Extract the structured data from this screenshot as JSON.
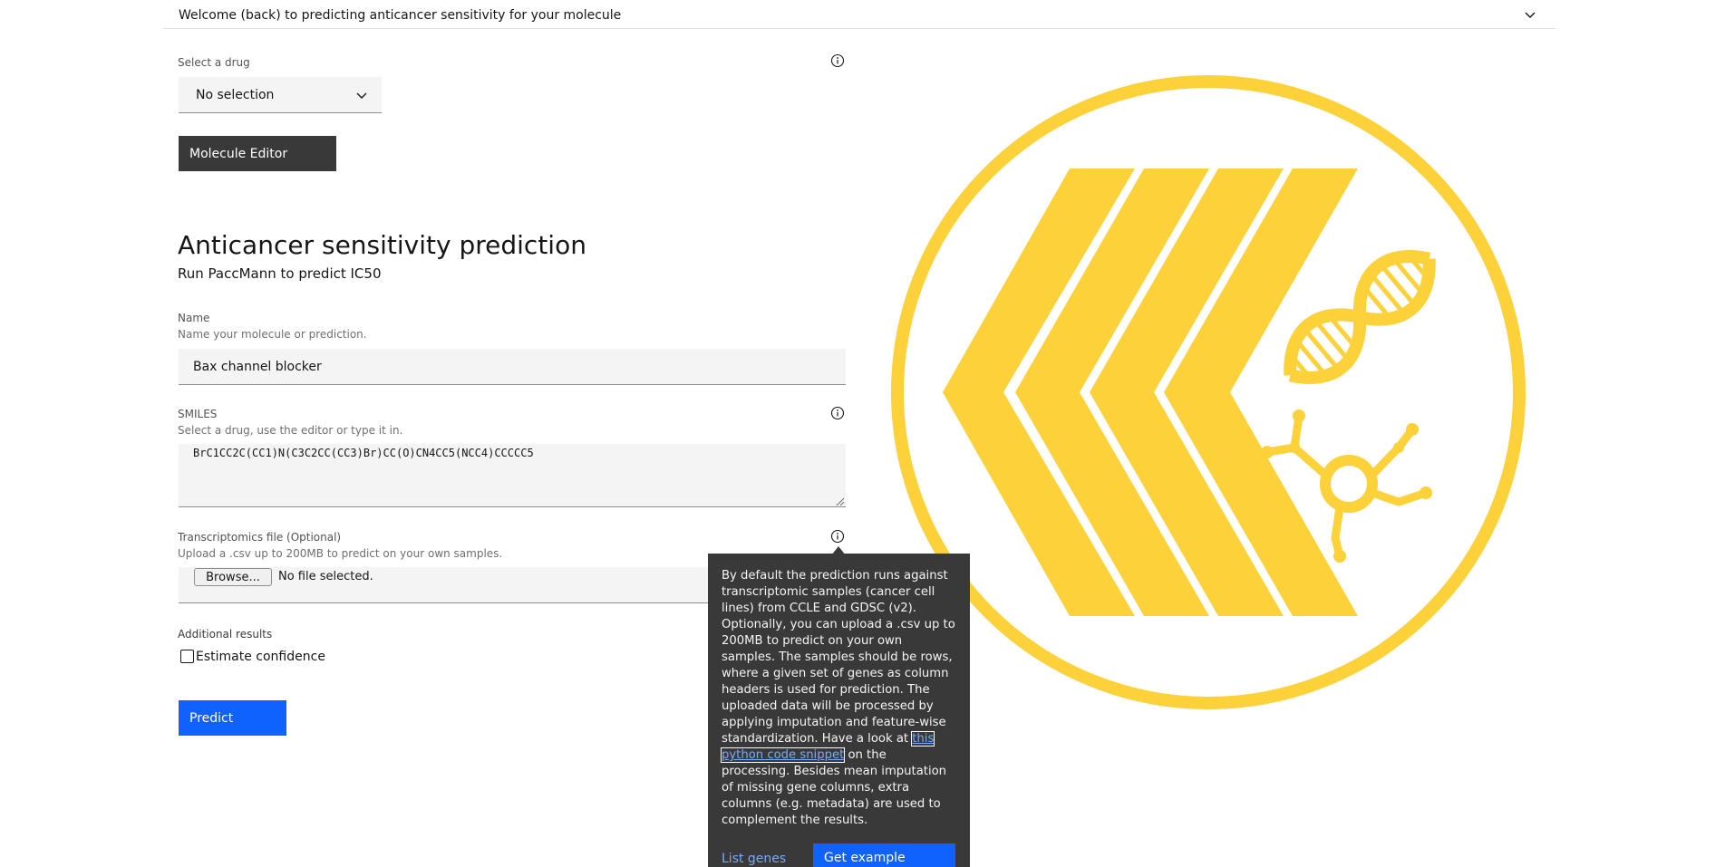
{
  "accordion": {
    "title": "Welcome (back) to predicting anticancer sensitivity for your molecule"
  },
  "drug_select": {
    "label": "Select a drug",
    "value": "No selection"
  },
  "molecule_editor_button": "Molecule Editor",
  "section": {
    "title": "Anticancer sensitivity prediction",
    "subtitle": "Run PaccMann to predict IC50"
  },
  "name_field": {
    "label": "Name",
    "helper": "Name your molecule or prediction.",
    "value": "Bax channel blocker"
  },
  "smiles_field": {
    "label": "SMILES",
    "helper": "Select a drug, use the editor or type it in.",
    "value": "BrC1CC2C(CC1)N(C3C2CC(CC3)Br)CC(O)CN4CC5(NCC4)CCCCC5"
  },
  "transcriptomics_field": {
    "label": "Transcriptomics file (Optional)",
    "helper": "Upload a .csv up to 200MB to predict on your own samples.",
    "browse_label": "Browse...",
    "file_status": "No file selected."
  },
  "additional_results": {
    "label": "Additional results",
    "checkbox_label": "Estimate confidence"
  },
  "predict_button": "Predict",
  "tooltip": {
    "text_before": "By default the prediction runs against transcriptomic samples (cancer cell lines) from CCLE and GDSC (v2). Optionally, you can upload a .csv up to 200MB to predict on your own samples. The samples should be rows, where a given set of genes as column headers is used for prediction. The uploaded data will be processed by applying imputation and feature-wise standardization. Have a look at ",
    "link_text": "this python code snippet",
    "text_after": " on the processing. Besides mean imputation of missing gene columns, extra columns (e.g. metadata) are used to complement the results.",
    "list_genes": "List genes",
    "get_example": "Get example"
  },
  "icons": {
    "info": "info-icon",
    "chevron": "chevron-down-icon",
    "logo": "paccmann-logo"
  },
  "colors": {
    "logo_yellow": "#fdd13a",
    "primary_blue": "#0f62fe",
    "dark_button": "#393939",
    "field_bg": "#f4f4f4",
    "link_blue": "#78a9ff"
  }
}
